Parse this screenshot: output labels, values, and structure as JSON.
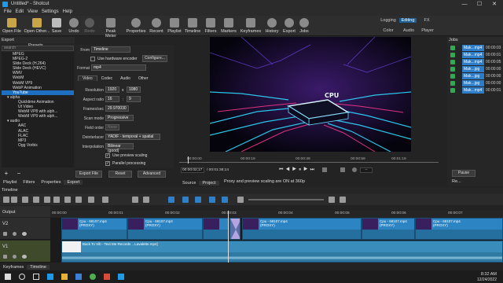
{
  "window": {
    "title": "Untitled* - Shotcut",
    "minimize": "—",
    "maximize": "☐",
    "close": "✕"
  },
  "menu": [
    "File",
    "Edit",
    "View",
    "Settings",
    "Help"
  ],
  "toolbar": {
    "items": [
      {
        "label": "Open File",
        "icon": "open-file-icon"
      },
      {
        "label": "Open Other...",
        "icon": "open-other-icon"
      },
      {
        "label": "Save",
        "icon": "save-icon"
      },
      {
        "label": "Undo",
        "icon": "undo-icon"
      },
      {
        "label": "Redo",
        "icon": "redo-icon"
      },
      {
        "label": "Peak Meter",
        "icon": "peak-meter-icon"
      },
      {
        "label": "Properties",
        "icon": "properties-icon"
      },
      {
        "label": "Recent",
        "icon": "recent-icon"
      },
      {
        "label": "Playlist",
        "icon": "playlist-icon"
      },
      {
        "label": "Timeline",
        "icon": "timeline-icon"
      },
      {
        "label": "Filters",
        "icon": "filters-icon"
      },
      {
        "label": "Markers",
        "icon": "markers-icon"
      },
      {
        "label": "Keyframes",
        "icon": "keyframes-icon"
      },
      {
        "label": "History",
        "icon": "history-icon"
      },
      {
        "label": "Export",
        "icon": "export-icon"
      },
      {
        "label": "Jobs",
        "icon": "jobs-icon"
      }
    ],
    "layouts_top": [
      "Logging",
      "Editing",
      "FX"
    ],
    "layouts_bottom": [
      "Color",
      "Audio",
      "Player"
    ],
    "active_layout": "Editing"
  },
  "export_panel": {
    "header": "Export",
    "presets_label": "Presets",
    "search_placeholder": "search",
    "presets": [
      {
        "label": "MPEG",
        "indent": 2
      },
      {
        "label": "MPEG-2",
        "indent": 2
      },
      {
        "label": "Slide Deck (H.264)",
        "indent": 2
      },
      {
        "label": "Slide Deck (HEVC)",
        "indent": 2
      },
      {
        "label": "WMV",
        "indent": 2
      },
      {
        "label": "WebM",
        "indent": 2
      },
      {
        "label": "WebM VP9",
        "indent": 2
      },
      {
        "label": "WebP Animation",
        "indent": 2
      },
      {
        "label": "YouTube",
        "indent": 2,
        "selected": true
      },
      {
        "label": "▾ alpha",
        "indent": 1
      },
      {
        "label": "Quicktime Animation",
        "indent": 3
      },
      {
        "label": "Ut Video",
        "indent": 3
      },
      {
        "label": "WebM VP8 with alph...",
        "indent": 3
      },
      {
        "label": "WebM VP9 with alph...",
        "indent": 3
      },
      {
        "label": "▾ audio",
        "indent": 1
      },
      {
        "label": "AAC",
        "indent": 3
      },
      {
        "label": "ALAC",
        "indent": 3
      },
      {
        "label": "FLAC",
        "indent": 3
      },
      {
        "label": "MP3",
        "indent": 3
      },
      {
        "label": "Ogg Vorbis",
        "indent": 3
      }
    ],
    "from_label": "From",
    "from_value": "Timeline",
    "hw_encoder_label": "Use hardware encoder",
    "configure_label": "Configure...",
    "format_label": "Format",
    "format_value": "mp4",
    "tabs": [
      "Video",
      "Codec",
      "Audio",
      "Other"
    ],
    "resolution_label": "Resolution",
    "res_w": "1920",
    "res_x": "x",
    "res_h": "1080",
    "aspect_label": "Aspect ratio",
    "aspect_w": "16",
    "aspect_sep": ":",
    "aspect_h": "9",
    "fps_label": "Frames/sec",
    "fps_value": "29.970030",
    "scan_label": "Scan mode",
    "scan_value": "Progressive",
    "field_label": "Field order",
    "field_value": "None",
    "deint_label": "Deinterlacer",
    "deint_value": "YADIF - temporal + spatial",
    "interp_label": "Interpolation",
    "interp_value": "Bilinear (good)",
    "preview_scaling_label": "Use preview scaling",
    "parallel_label": "Parallel processing",
    "export_file_label": "Export File",
    "reset_label": "Reset",
    "advanced_label": "Advanced"
  },
  "viewer": {
    "overlay_text": "CPU",
    "current_time": "00:00:02;17",
    "total_time": "/ 00:01:38;14",
    "ruler_ticks": [
      "00:00:00",
      "00:00:19",
      "00:00:39",
      "00:00:59",
      "00:01:19"
    ],
    "tabs": [
      "Source",
      "Project"
    ],
    "status_text": "Proxy and preview scaling are ON at 360p",
    "zoom_value": "--"
  },
  "jobs": {
    "header": "Jobs",
    "items": [
      {
        "name": "Mak...mp4",
        "time": "00:00:03"
      },
      {
        "name": "Mak...mp4",
        "time": "00:00:01"
      },
      {
        "name": "Mak...mp4",
        "time": "00:00:05"
      },
      {
        "name": "Mak...jpg",
        "time": "00:00:00"
      },
      {
        "name": "Mak...jpg",
        "time": "00:00:00"
      },
      {
        "name": "Mak...jpg",
        "time": "00:00:00"
      },
      {
        "name": "Mak...mp4",
        "time": "00:00:01"
      }
    ],
    "pause_label": "Pause",
    "re_label": "Re..."
  },
  "bottom_tabs": [
    "Playlist",
    "Filters",
    "Properties",
    "Export"
  ],
  "timeline": {
    "header": "Timeline",
    "output_label": "Output",
    "ruler": [
      "00:00:00",
      "00:00:01",
      "00:00:02",
      "00:00:03",
      "00:00:04",
      "00:00:05",
      "00:00:06",
      "00:00:07",
      "00:00:08"
    ],
    "tracks": [
      {
        "name": "V2"
      },
      {
        "name": "V1"
      }
    ],
    "v2_clip_label": "Cpu - 69107.mp4",
    "v2_clip_proxy": "(PROXY)",
    "v1_clip_label": "Back To Vib - Text Me Records ...Lavalette.mp4]",
    "bottom_tabs": [
      "Keyframes",
      "Timeline"
    ]
  },
  "taskbar": {
    "time": "8:32 AM",
    "date": "12/24/2022"
  },
  "colors": {
    "accent": "#1e9be8",
    "selected": "#1e6fbf",
    "clip_video": "#2c85c2",
    "clip_audio": "#3a8dba",
    "playhead": "#c8c8c8"
  }
}
